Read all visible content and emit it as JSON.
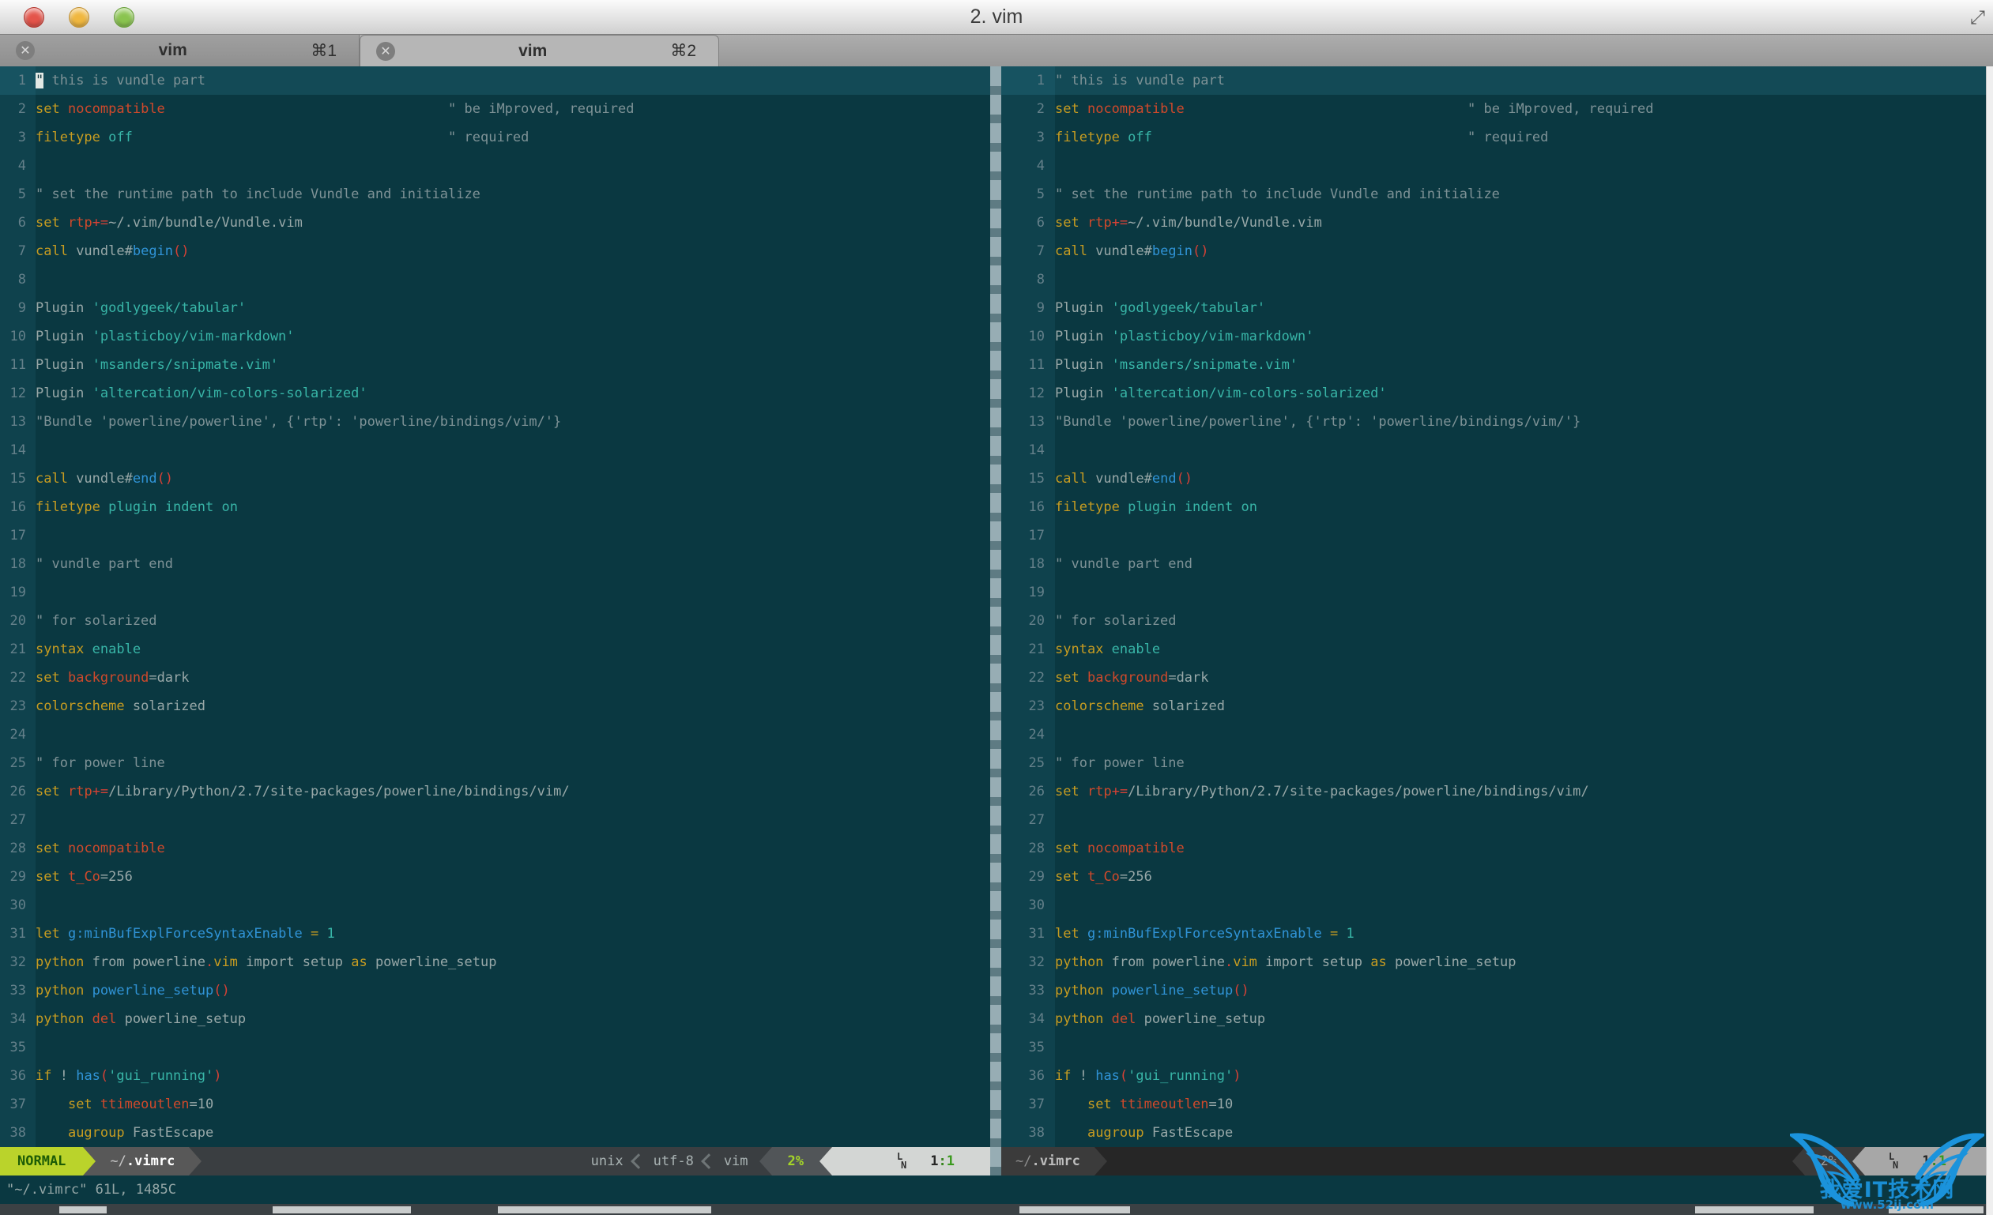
{
  "window": {
    "title": "2. vim",
    "fullscreen_icon": "expand"
  },
  "tabs": [
    {
      "label": "vim",
      "shortcut": "⌘1",
      "close": "✕"
    },
    {
      "label": "vim",
      "shortcut": "⌘2",
      "close": "✕"
    }
  ],
  "editor": {
    "lines": [
      {
        "n": "1",
        "cl": true,
        "seg": [
          [
            "cur",
            "\""
          ],
          [
            "cm",
            " this is vundle part"
          ]
        ]
      },
      {
        "n": "2",
        "seg": [
          [
            "kw",
            "set"
          ],
          [
            "tx",
            " "
          ],
          [
            "id",
            "nocompatible"
          ],
          [
            "tx",
            "                                   "
          ],
          [
            "cm",
            "\" be iMproved, required"
          ]
        ]
      },
      {
        "n": "3",
        "seg": [
          [
            "kw",
            "filetype"
          ],
          [
            "tx",
            " "
          ],
          [
            "va",
            "off"
          ],
          [
            "tx",
            "                                       "
          ],
          [
            "cm",
            "\" required"
          ]
        ]
      },
      {
        "n": "4",
        "seg": []
      },
      {
        "n": "5",
        "seg": [
          [
            "cm",
            "\" set the runtime path to include Vundle and initialize"
          ]
        ]
      },
      {
        "n": "6",
        "seg": [
          [
            "kw",
            "set"
          ],
          [
            "tx",
            " "
          ],
          [
            "id",
            "rtp"
          ],
          [
            "pr",
            "+="
          ],
          [
            "tx",
            "~/.vim/bundle/Vundle.vim"
          ]
        ]
      },
      {
        "n": "7",
        "seg": [
          [
            "kw",
            "call"
          ],
          [
            "tx",
            " vundle#"
          ],
          [
            "fn",
            "begin"
          ],
          [
            "pr",
            "()"
          ]
        ]
      },
      {
        "n": "8",
        "seg": []
      },
      {
        "n": "9",
        "seg": [
          [
            "tx",
            "Plugin "
          ],
          [
            "va",
            "'godlygeek/tabular'"
          ]
        ]
      },
      {
        "n": "10",
        "seg": [
          [
            "tx",
            "Plugin "
          ],
          [
            "va",
            "'plasticboy/vim-markdown'"
          ]
        ]
      },
      {
        "n": "11",
        "seg": [
          [
            "tx",
            "Plugin "
          ],
          [
            "va",
            "'msanders/snipmate.vim'"
          ]
        ]
      },
      {
        "n": "12",
        "seg": [
          [
            "tx",
            "Plugin "
          ],
          [
            "va",
            "'altercation/vim-colors-solarized'"
          ]
        ]
      },
      {
        "n": "13",
        "seg": [
          [
            "cm",
            "\"Bundle 'powerline/powerline', {'rtp': 'powerline/bindings/vim/'}"
          ]
        ]
      },
      {
        "n": "14",
        "seg": []
      },
      {
        "n": "15",
        "seg": [
          [
            "kw",
            "call"
          ],
          [
            "tx",
            " vundle#"
          ],
          [
            "fn",
            "end"
          ],
          [
            "pr",
            "()"
          ]
        ]
      },
      {
        "n": "16",
        "seg": [
          [
            "kw",
            "filetype"
          ],
          [
            "tx",
            " "
          ],
          [
            "va",
            "plugin"
          ],
          [
            "tx",
            " "
          ],
          [
            "va",
            "indent"
          ],
          [
            "tx",
            " "
          ],
          [
            "va",
            "on"
          ]
        ]
      },
      {
        "n": "17",
        "seg": []
      },
      {
        "n": "18",
        "seg": [
          [
            "cm",
            "\" vundle part end"
          ]
        ]
      },
      {
        "n": "19",
        "seg": []
      },
      {
        "n": "20",
        "seg": [
          [
            "cm",
            "\" for solarized"
          ]
        ]
      },
      {
        "n": "21",
        "seg": [
          [
            "kw",
            "syntax"
          ],
          [
            "tx",
            " "
          ],
          [
            "va",
            "enable"
          ]
        ]
      },
      {
        "n": "22",
        "seg": [
          [
            "kw",
            "set"
          ],
          [
            "tx",
            " "
          ],
          [
            "id",
            "background"
          ],
          [
            "tx",
            "=dark"
          ]
        ]
      },
      {
        "n": "23",
        "seg": [
          [
            "kw",
            "colorscheme"
          ],
          [
            "tx",
            " solarized"
          ]
        ]
      },
      {
        "n": "24",
        "seg": []
      },
      {
        "n": "25",
        "seg": [
          [
            "cm",
            "\" for power line"
          ]
        ]
      },
      {
        "n": "26",
        "seg": [
          [
            "kw",
            "set"
          ],
          [
            "tx",
            " "
          ],
          [
            "id",
            "rtp"
          ],
          [
            "pr",
            "+="
          ],
          [
            "tx",
            "/Library/Python/2.7/site-packages/powerline/bindings/vim/"
          ]
        ]
      },
      {
        "n": "27",
        "seg": []
      },
      {
        "n": "28",
        "seg": [
          [
            "kw",
            "set"
          ],
          [
            "tx",
            " "
          ],
          [
            "id",
            "nocompatible"
          ]
        ]
      },
      {
        "n": "29",
        "seg": [
          [
            "kw",
            "set"
          ],
          [
            "tx",
            " "
          ],
          [
            "id",
            "t_Co"
          ],
          [
            "tx",
            "=256"
          ]
        ]
      },
      {
        "n": "30",
        "seg": []
      },
      {
        "n": "31",
        "seg": [
          [
            "kw",
            "let"
          ],
          [
            "tx",
            " "
          ],
          [
            "fn",
            "g:minBufExplForceSyntaxEnable"
          ],
          [
            "tx",
            " "
          ],
          [
            "kw",
            "="
          ],
          [
            "tx",
            " "
          ],
          [
            "va",
            "1"
          ]
        ]
      },
      {
        "n": "32",
        "seg": [
          [
            "kw",
            "python"
          ],
          [
            "tx",
            " from powerline"
          ],
          [
            "pr",
            "."
          ],
          [
            "kw",
            "vim"
          ],
          [
            "tx",
            " import setup "
          ],
          [
            "kw",
            "as"
          ],
          [
            "tx",
            " powerline_setup"
          ]
        ]
      },
      {
        "n": "33",
        "seg": [
          [
            "kw",
            "python"
          ],
          [
            "tx",
            " "
          ],
          [
            "fn",
            "powerline_setup"
          ],
          [
            "pr",
            "()"
          ]
        ]
      },
      {
        "n": "34",
        "seg": [
          [
            "kw",
            "python"
          ],
          [
            "tx",
            " "
          ],
          [
            "id",
            "del"
          ],
          [
            "tx",
            " powerline_setup"
          ]
        ]
      },
      {
        "n": "35",
        "seg": []
      },
      {
        "n": "36",
        "seg": [
          [
            "kw",
            "if"
          ],
          [
            "tx",
            " ! "
          ],
          [
            "fn",
            "has"
          ],
          [
            "pr",
            "("
          ],
          [
            "va",
            "'gui_running'"
          ],
          [
            "pr",
            ")"
          ]
        ]
      },
      {
        "n": "37",
        "seg": [
          [
            "tx",
            "    "
          ],
          [
            "kw",
            "set"
          ],
          [
            "tx",
            " "
          ],
          [
            "id",
            "ttimeoutlen"
          ],
          [
            "tx",
            "=10"
          ]
        ]
      },
      {
        "n": "38",
        "seg": [
          [
            "tx",
            "    "
          ],
          [
            "kw",
            "augroup"
          ],
          [
            "tx",
            " FastEscape"
          ]
        ]
      }
    ],
    "status_active": {
      "mode": "NORMAL",
      "file_dir": "~/",
      "file_name": ".vimrc",
      "enc": "unix",
      "fmt": "utf-8",
      "ft": "vim",
      "percent": "2%",
      "ln_top": "L",
      "ln_bot": "N",
      "line": "1",
      "colon": ":",
      "col": "1"
    },
    "status_inactive": {
      "file_dir": "~/",
      "file_name": ".vimrc",
      "percent": "2%",
      "ln_top": "L",
      "ln_bot": "N",
      "line": "1",
      "colon": ":",
      "col": "1"
    },
    "cmdline": "\"~/.vimrc\" 61L, 1485C"
  },
  "watermark": {
    "title": "我爱IT技术网",
    "url": "www.52ij.com"
  },
  "colors": {
    "background": "#0a3841",
    "keyword": "#c79c21",
    "option": "#d0492b",
    "string": "#38b5a7",
    "function": "#3093d6",
    "paren": "#d64136",
    "comment": "#7e9296",
    "mode_badge": "#bad32b",
    "watermark_blue": "#1b93dc"
  }
}
